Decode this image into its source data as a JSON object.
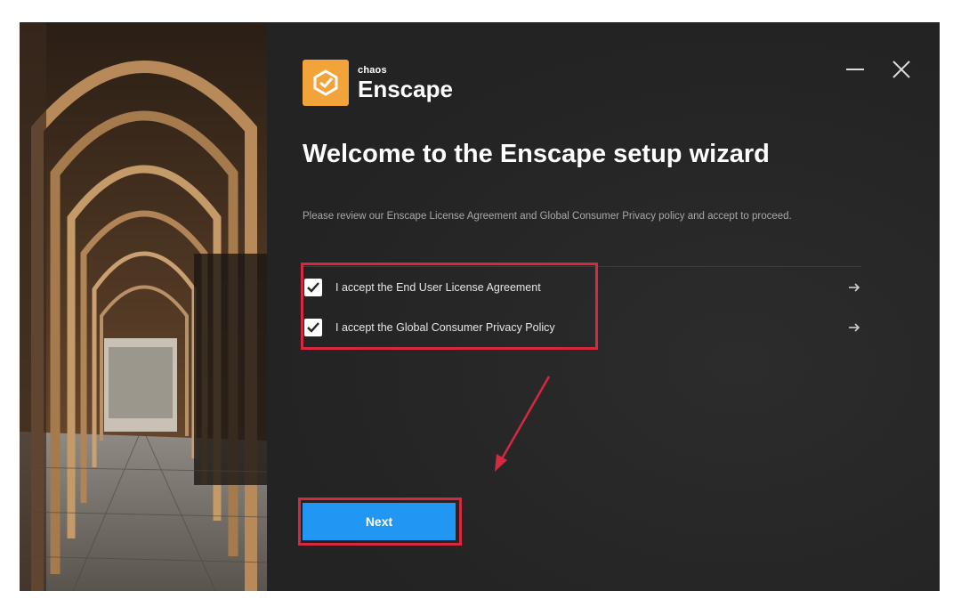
{
  "window": {
    "brand": "chaos",
    "product": "Enscape"
  },
  "header": {
    "title": "Welcome to the Enscape setup wizard",
    "intro": "Please review our Enscape License Agreement and Global Consumer Privacy policy and accept to proceed."
  },
  "agreements": [
    {
      "label": "I accept the End User License Agreement",
      "checked": true
    },
    {
      "label": "I accept the Global Consumer Privacy Policy",
      "checked": true
    }
  ],
  "footer": {
    "next_label": "Next"
  },
  "icons": {
    "logo": "enscape-logo-icon",
    "minimize": "minimize-icon",
    "close": "close-icon",
    "check": "checkmark-icon",
    "arrow": "arrow-right-icon"
  },
  "colors": {
    "accent": "#2196f3",
    "logo": "#f2a33a",
    "highlight": "#d6283f",
    "background": "#252525"
  }
}
